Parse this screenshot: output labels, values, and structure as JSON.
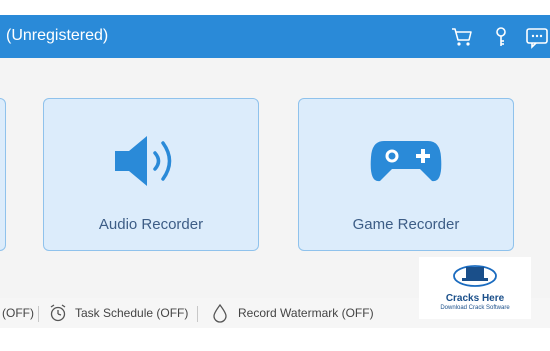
{
  "titlebar": {
    "title": "(Unregistered)",
    "icons": [
      "cart-icon",
      "key-icon",
      "feedback-icon"
    ]
  },
  "cards": [
    {
      "label": "Audio Recorder",
      "icon": "speaker-icon"
    },
    {
      "label": "Game Recorder",
      "icon": "gamepad-icon"
    }
  ],
  "statusbar": {
    "item1": "(OFF)",
    "task_schedule": "Task Schedule (OFF)",
    "record_watermark": "Record Watermark (OFF)"
  },
  "watermark": {
    "title": "Cracks Here",
    "subtitle": "Download Crack Software"
  },
  "colors": {
    "titlebar": "#2a8ad8",
    "card_bg": "#dcecfb",
    "card_border": "#8fc2ec",
    "icon_blue": "#2a8ad8",
    "card_label": "#3d5d86"
  }
}
